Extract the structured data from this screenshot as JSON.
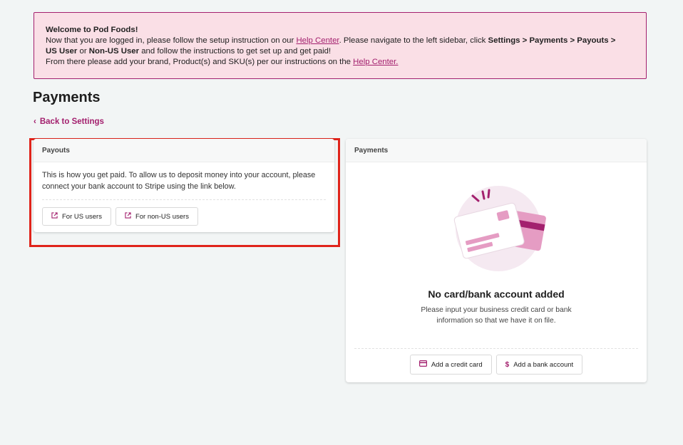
{
  "banner": {
    "title": "Welcome to Pod Foods!",
    "line1_a": "Now that you are logged in, please follow the setup instruction on our ",
    "line1_link": "Help Center",
    "line1_b": ". Please navigate to the left sidebar, click ",
    "line1_path": "Settings > Payments > Payouts >",
    "line2_us": "US User",
    "line2_or": " or ",
    "line2_nonus": "Non-US User",
    "line2_rest": " and follow the instructions to get set up and get paid!",
    "line3_a": "From there please add your brand, Product(s) and SKU(s) per our instructions on the ",
    "line3_link": "Help Center."
  },
  "page": {
    "title": "Payments",
    "back_chevron": "‹",
    "back_label": "Back to Settings"
  },
  "payouts": {
    "header": "Payouts",
    "description": "This is how you get paid. To allow us to deposit money into your account, please connect your bank account to Stripe using the link below.",
    "us_button": "For US users",
    "nonus_button": "For non-US users"
  },
  "payments": {
    "header": "Payments",
    "empty_title": "No card/bank account added",
    "empty_desc": "Please input your business credit card or bank information so that we have it on file.",
    "add_card_button": "Add a credit card",
    "add_bank_button": "Add a bank account"
  },
  "icons": {
    "external_link": "external-link-icon",
    "credit_card": "credit-card-icon",
    "dollar": "dollar-icon"
  },
  "colors": {
    "brand": "#a3206e",
    "banner_bg": "#fadfe6",
    "highlight": "#e0241b",
    "background": "#f2f5f5"
  }
}
